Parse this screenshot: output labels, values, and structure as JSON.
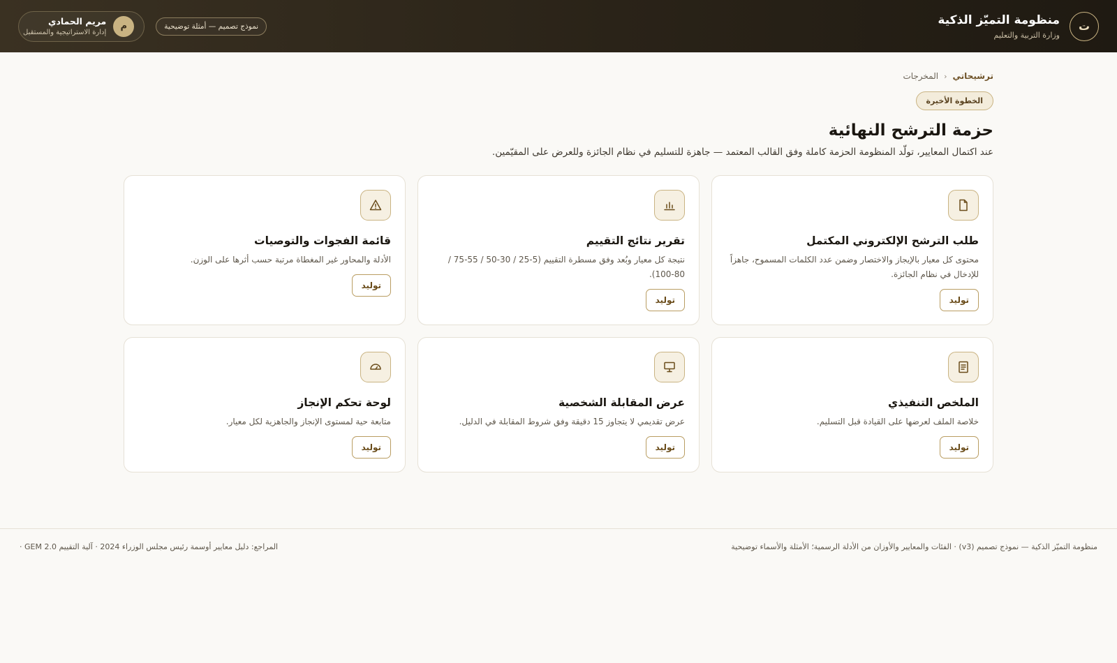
{
  "header": {
    "logo_letter": "ت",
    "title": "منظومة التميّز الذكية",
    "subtitle": "وزارة التربية والتعليم",
    "demo_label": "نموذج تصميم — أمثلة توضيحية",
    "user": {
      "initial": "م",
      "name": "مريم الحمادي",
      "role": "إدارة الاستراتيجية والمستقبل"
    }
  },
  "breadcrumb": {
    "home": "ترشيحاتي",
    "separator": "‹",
    "current": "المخرجات"
  },
  "page": {
    "badge": "الخطوة الأخيرة",
    "title": "حزمة الترشح النهائية",
    "description": "عند اكتمال المعايير، تولّد المنظومة الحزمة كاملة وفق القالب المعتمد — جاهزة للتسليم في نظام الجائزة وللعرض على المقيّمين."
  },
  "cards": [
    {
      "icon": "document-icon",
      "title": "طلب الترشح الإلكتروني المكتمل",
      "description": "محتوى كل معيار بالإيجاز والاختصار وضمن عدد الكلمات المسموح، جاهزاً للإدخال في نظام الجائزة.",
      "button": "توليد"
    },
    {
      "icon": "bar-chart-icon",
      "title": "تقرير نتائج التقييم",
      "description": "نتيجة كل معيار وبُعد وفق مسطرة التقييم (5-25 / 30-50 / 55-75 / 80-100).",
      "button": "توليد"
    },
    {
      "icon": "warning-icon",
      "title": "قائمة الفجوات والتوصيات",
      "description": "الأدلة والمحاور غير المغطاة مرتبة حسب أثرها على الوزن.",
      "button": "توليد"
    },
    {
      "icon": "summary-icon",
      "title": "الملخص التنفيذي",
      "description": "خلاصة الملف لعرضها على القيادة قبل التسليم.",
      "button": "توليد"
    },
    {
      "icon": "presentation-icon",
      "title": "عرض المقابلة الشخصية",
      "description": "عرض تقديمي لا يتجاوز 15 دقيقة وفق شروط المقابلة في الدليل.",
      "button": "توليد"
    },
    {
      "icon": "gauge-icon",
      "title": "لوحة تحكم الإنجاز",
      "description": "متابعة حية لمستوى الإنجاز والجاهزية لكل معيار.",
      "button": "توليد"
    }
  ],
  "footer": {
    "right": "منظومة التميّز الذكية — نموذج تصميم (v3) · الفئات والمعايير والأوزان من الأدلة الرسمية؛ الأمثلة والأسماء توضيحية",
    "left": "المراجع: دليل معايير أوسمة رئيس مجلس الوزراء 2024 · آلية التقييم GEM 2.0 ·"
  },
  "colors": {
    "header_bg": "#2a2318",
    "accent": "#c9b382",
    "accent_text": "#6a4c1a",
    "page_bg": "#faf9f6"
  }
}
